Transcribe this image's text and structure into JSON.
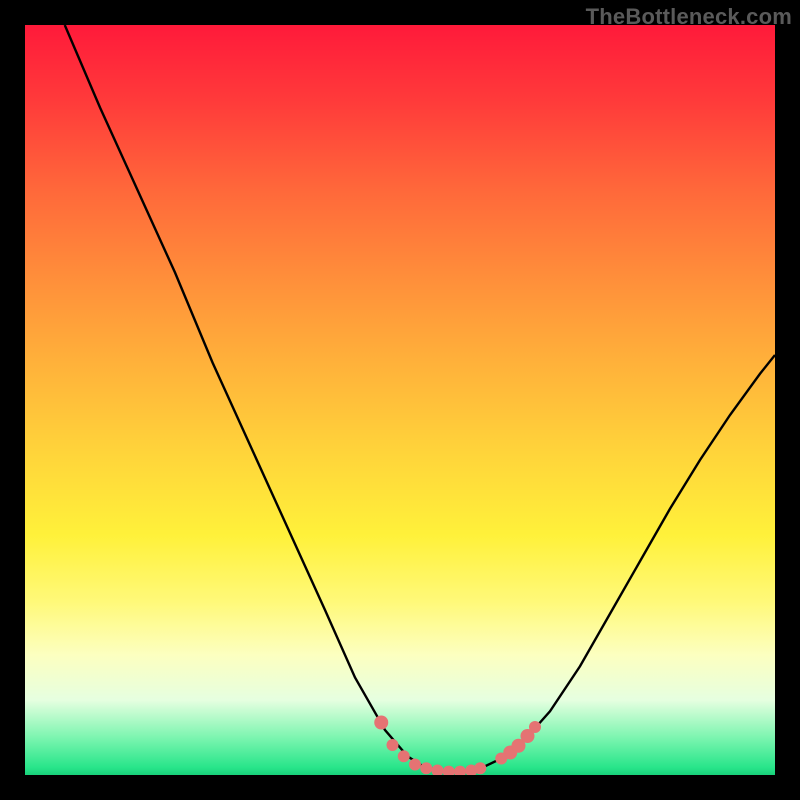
{
  "watermark": "TheBottleneck.com",
  "chart_data": {
    "type": "line",
    "title": "",
    "xlabel": "",
    "ylabel": "",
    "xlim": [
      0,
      100
    ],
    "ylim": [
      0,
      100
    ],
    "grid": false,
    "series": [
      {
        "name": "curve",
        "points": [
          {
            "x": 5.3,
            "y": 100.0
          },
          {
            "x": 10.0,
            "y": 89.0
          },
          {
            "x": 15.0,
            "y": 78.0
          },
          {
            "x": 20.0,
            "y": 67.0
          },
          {
            "x": 25.0,
            "y": 55.0
          },
          {
            "x": 30.0,
            "y": 44.0
          },
          {
            "x": 35.0,
            "y": 33.0
          },
          {
            "x": 40.0,
            "y": 22.0
          },
          {
            "x": 44.0,
            "y": 13.0
          },
          {
            "x": 48.0,
            "y": 6.0
          },
          {
            "x": 51.0,
            "y": 2.5
          },
          {
            "x": 53.0,
            "y": 1.2
          },
          {
            "x": 55.0,
            "y": 0.6
          },
          {
            "x": 57.0,
            "y": 0.4
          },
          {
            "x": 59.0,
            "y": 0.5
          },
          {
            "x": 61.0,
            "y": 1.0
          },
          {
            "x": 63.5,
            "y": 2.2
          },
          {
            "x": 66.0,
            "y": 4.0
          },
          {
            "x": 70.0,
            "y": 8.5
          },
          {
            "x": 74.0,
            "y": 14.5
          },
          {
            "x": 78.0,
            "y": 21.5
          },
          {
            "x": 82.0,
            "y": 28.5
          },
          {
            "x": 86.0,
            "y": 35.5
          },
          {
            "x": 90.0,
            "y": 42.0
          },
          {
            "x": 94.0,
            "y": 48.0
          },
          {
            "x": 98.0,
            "y": 53.5
          },
          {
            "x": 100.0,
            "y": 56.0
          }
        ]
      }
    ],
    "markers": [
      {
        "x": 47.5,
        "y": 7.0,
        "r": 7
      },
      {
        "x": 49.0,
        "y": 4.0,
        "r": 6
      },
      {
        "x": 50.5,
        "y": 2.5,
        "r": 6
      },
      {
        "x": 52.0,
        "y": 1.4,
        "r": 6
      },
      {
        "x": 53.5,
        "y": 0.9,
        "r": 6
      },
      {
        "x": 55.0,
        "y": 0.6,
        "r": 6
      },
      {
        "x": 56.5,
        "y": 0.45,
        "r": 6
      },
      {
        "x": 58.0,
        "y": 0.45,
        "r": 6
      },
      {
        "x": 59.5,
        "y": 0.6,
        "r": 6
      },
      {
        "x": 60.7,
        "y": 0.9,
        "r": 6
      },
      {
        "x": 63.5,
        "y": 2.2,
        "r": 6
      },
      {
        "x": 64.7,
        "y": 3.0,
        "r": 7
      },
      {
        "x": 65.8,
        "y": 3.9,
        "r": 7
      },
      {
        "x": 67.0,
        "y": 5.2,
        "r": 7
      },
      {
        "x": 68.0,
        "y": 6.4,
        "r": 6
      }
    ],
    "marker_color": "#e57373",
    "curve_color": "#000000"
  }
}
